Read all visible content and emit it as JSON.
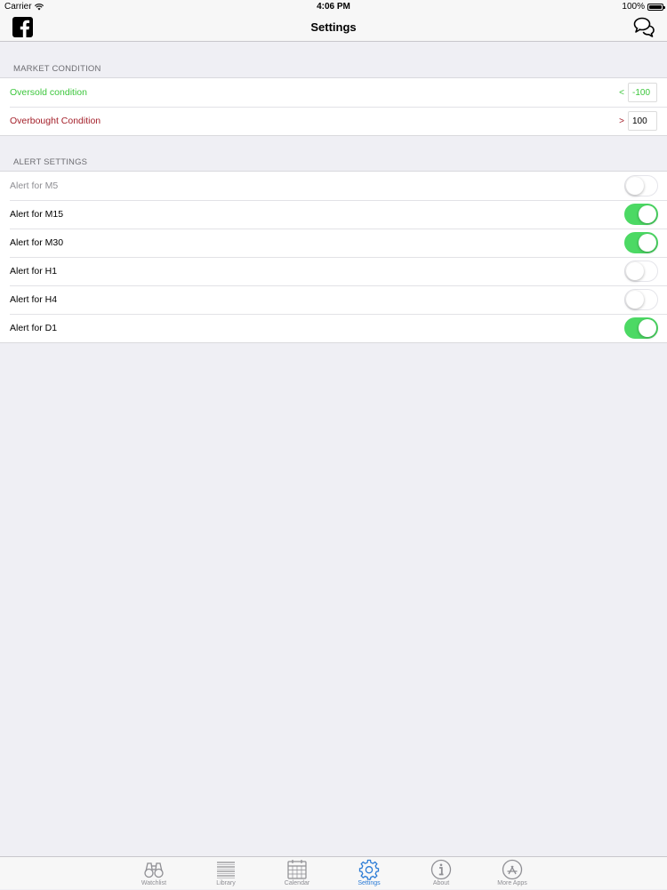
{
  "status": {
    "carrier": "Carrier",
    "time": "4:06 PM",
    "battery": "100%"
  },
  "nav": {
    "title": "Settings"
  },
  "sections": {
    "market": {
      "header": "MARKET CONDITION",
      "oversold": {
        "label": "Oversold condition",
        "sign": "<",
        "value": "-100"
      },
      "overbought": {
        "label": "Overbought Condition",
        "sign": ">",
        "value": "100"
      }
    },
    "alerts": {
      "header": "ALERT SETTINGS",
      "items": [
        {
          "label": "Alert for M5",
          "on": false
        },
        {
          "label": "Alert for M15",
          "on": true
        },
        {
          "label": "Alert for M30",
          "on": true
        },
        {
          "label": "Alert for H1",
          "on": false
        },
        {
          "label": "Alert for H4",
          "on": false
        },
        {
          "label": "Alert for D1",
          "on": true
        }
      ]
    }
  },
  "tabs": [
    {
      "label": "Watchlist",
      "icon": "binoculars-icon",
      "active": false
    },
    {
      "label": "Library",
      "icon": "list-icon",
      "active": false
    },
    {
      "label": "Calendar",
      "icon": "calendar-icon",
      "active": false
    },
    {
      "label": "Settings",
      "icon": "gear-icon",
      "active": true
    },
    {
      "label": "About",
      "icon": "info-icon",
      "active": false
    },
    {
      "label": "More Apps",
      "icon": "app-store-icon",
      "active": false
    }
  ],
  "colors": {
    "toggle_on": "#4cd964",
    "oversold": "#3cc63c",
    "overbought": "#a4202a",
    "tab_active": "#2a7bd6"
  }
}
